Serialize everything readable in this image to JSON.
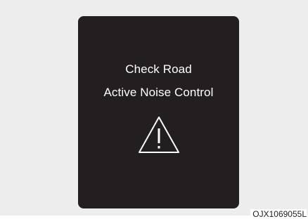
{
  "message": {
    "line1": "Check Road",
    "line2": "Active Noise Control",
    "icon": "warning-triangle-icon"
  },
  "figure_code": "OJX1069055L",
  "colors": {
    "background": "#ededed",
    "panel": "#231f20",
    "text": "#ffffff",
    "icon": "#ffffff"
  }
}
